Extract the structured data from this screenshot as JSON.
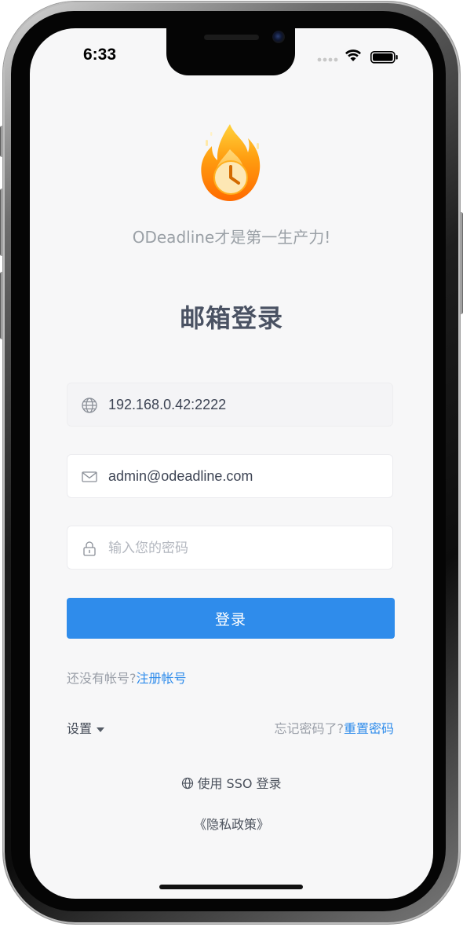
{
  "status_bar": {
    "time": "6:33"
  },
  "app": {
    "slogan": "ODeadline才是第一生产力!",
    "title": "邮箱登录"
  },
  "form": {
    "server": {
      "value": "192.168.0.42:2222",
      "icon": "globe-icon"
    },
    "email": {
      "value": "admin@odeadline.com",
      "icon": "mail-icon"
    },
    "password": {
      "placeholder": "输入您的密码",
      "value": "",
      "icon": "lock-icon"
    },
    "login_label": "登录"
  },
  "register": {
    "prompt": "还没有帐号?",
    "link": "注册帐号"
  },
  "settings": {
    "label": "设置"
  },
  "forgot": {
    "prompt": "忘记密码了?",
    "link": "重置密码"
  },
  "sso": {
    "label": "使用 SSO 登录"
  },
  "privacy": {
    "label": "《隐私政策》"
  },
  "colors": {
    "primary": "#2f8ceb",
    "title": "#4a5263",
    "muted": "#9a9fa8",
    "background": "#f7f7f8",
    "logo_flame": "#ff8a00",
    "logo_clock": "#fde3a7"
  }
}
